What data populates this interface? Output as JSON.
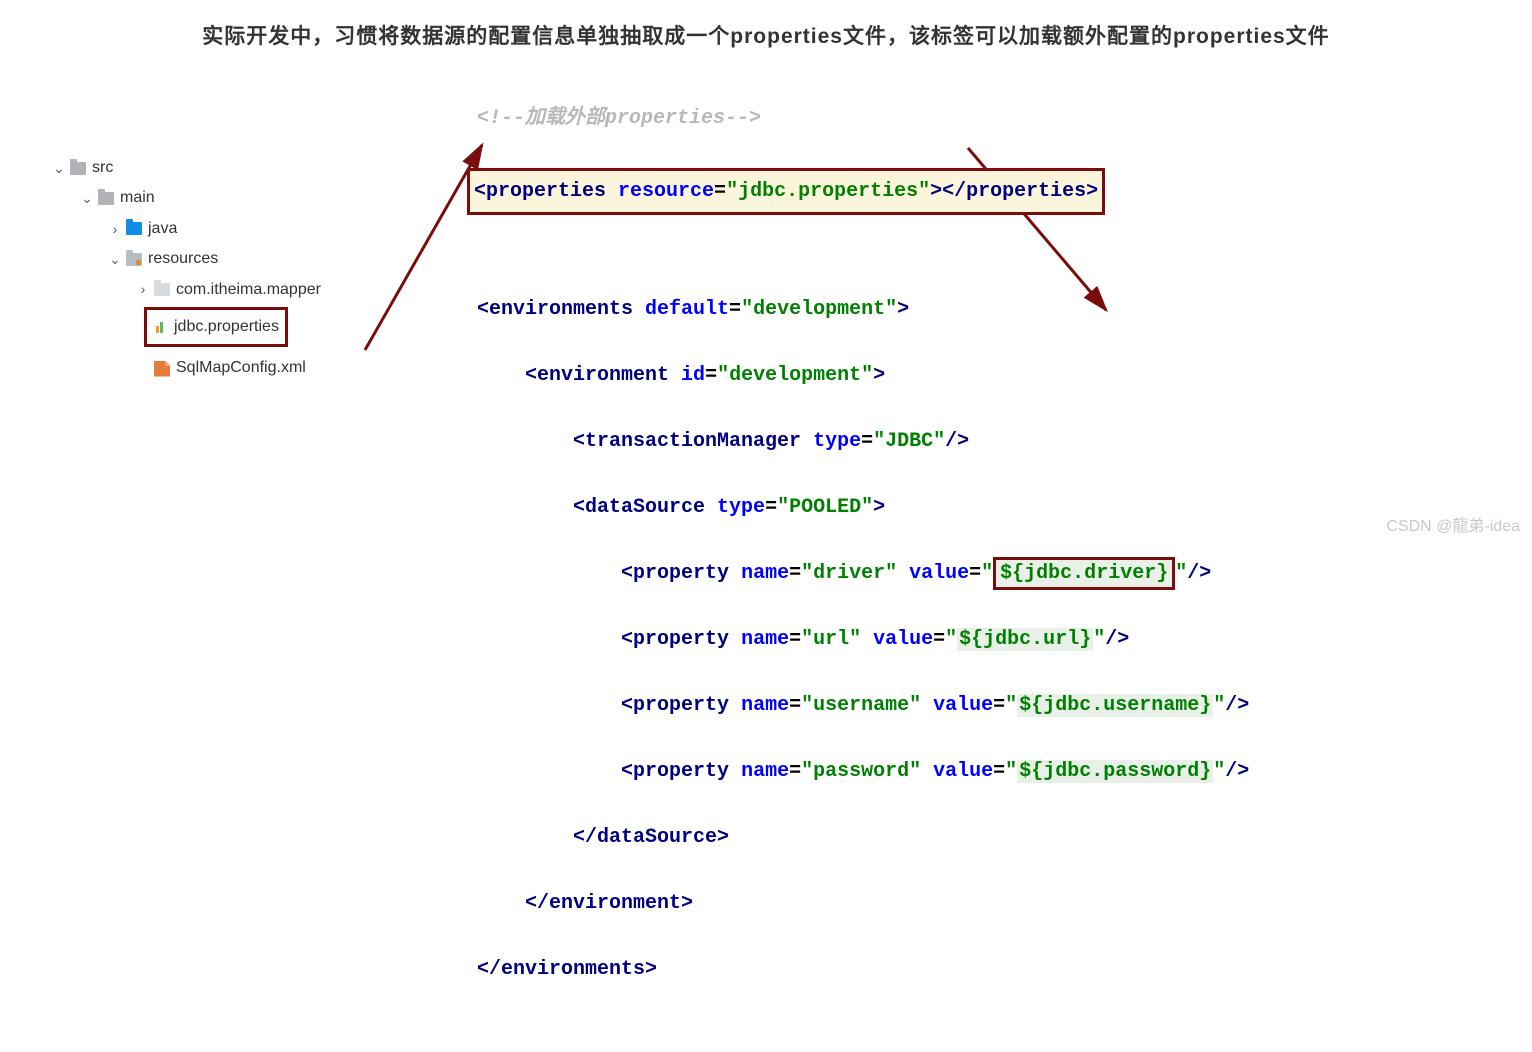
{
  "heading": "实际开发中，习惯将数据源的配置信息单独抽取成一个properties文件，该标签可以加载额外配置的properties文件",
  "tree": {
    "src": "src",
    "main": "main",
    "java": "java",
    "resources": "resources",
    "mapper": "com.itheima.mapper",
    "jdbc": "jdbc.properties",
    "sqlmap": "SqlMapConfig.xml"
  },
  "code": {
    "comment_open": "<!--",
    "comment_text": "加载外部properties",
    "comment_close": "-->",
    "props_open": "<properties ",
    "props_attr": "resource",
    "props_val": "\"jdbc.properties\"",
    "props_close": "></properties>",
    "envs_open": "<environments ",
    "envs_attr": "default",
    "envs_val": "\"development\"",
    "env_open": "<environment ",
    "env_attr": "id",
    "env_val": "\"development\"",
    "tm_open": "<transactionManager ",
    "tm_attr": "type",
    "tm_val": "\"JDBC\"",
    "ds_open": "<dataSource ",
    "ds_attr": "type",
    "ds_val": "\"POOLED\"",
    "prop_open": "<property ",
    "name_attr": "name",
    "value_attr": "value",
    "eq": "=",
    "gt": ">",
    "slash_gt": "/>",
    "p1_name": "\"driver\"",
    "p1_val": "\"${jdbc.driver}\"",
    "p2_name": "\"url\"",
    "p2_val": "\"${jdbc.url}\"",
    "p3_name": "\"username\"",
    "p3_val": "\"${jdbc.username}\"",
    "p4_name": "\"password\"",
    "p4_val": "\"${jdbc.password}\"",
    "ds_close": "</dataSource>",
    "env_close": "</environment>",
    "envs_close": "</environments>"
  },
  "watermark": "CSDN @龍弟-idea"
}
